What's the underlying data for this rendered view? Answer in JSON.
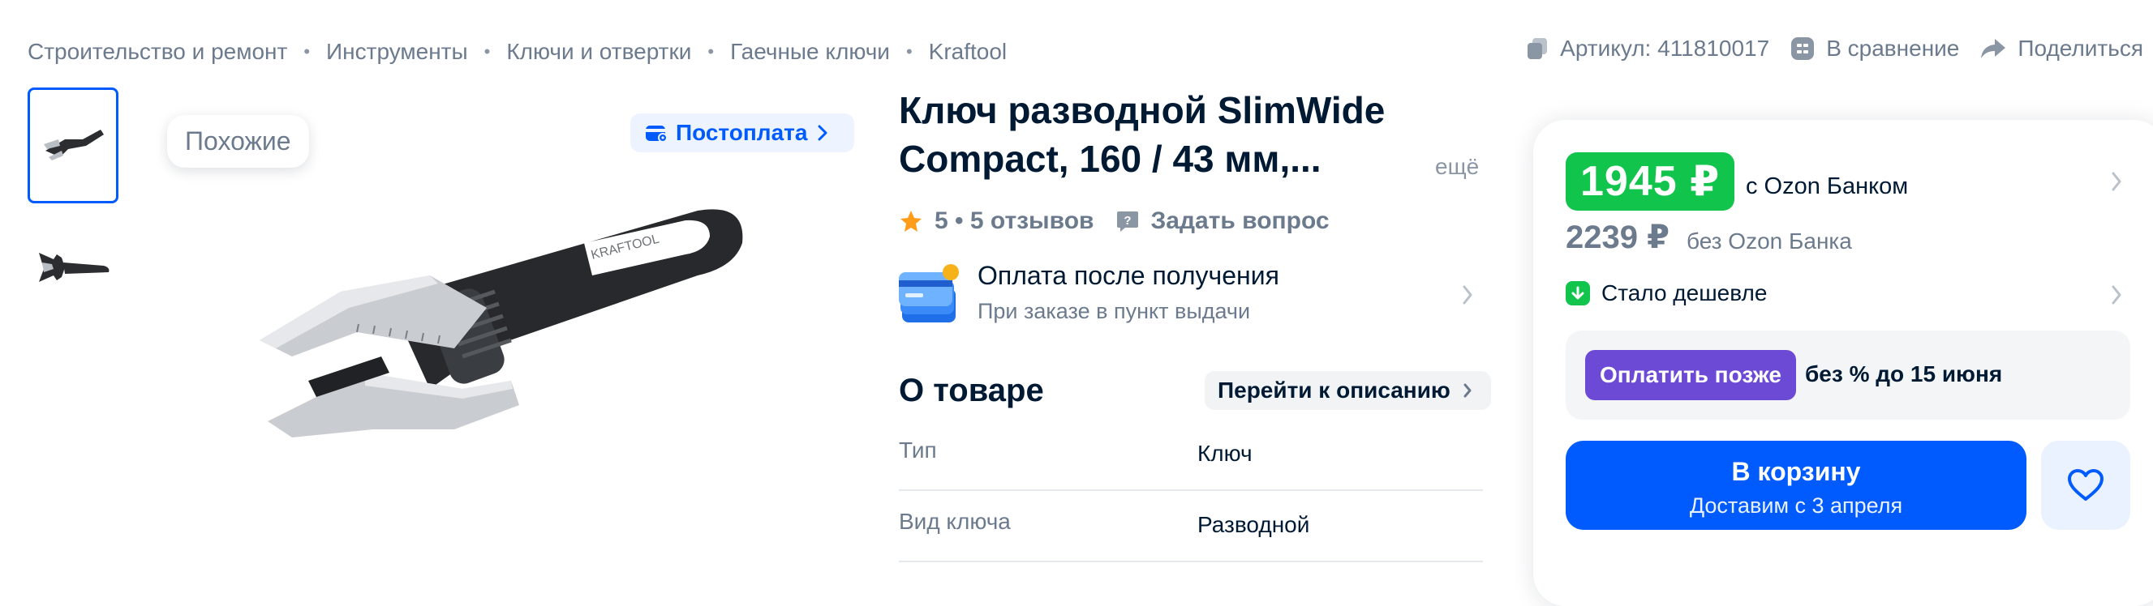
{
  "breadcrumbs": [
    "Строительство и ремонт",
    "Инструменты",
    "Ключи и отвертки",
    "Гаечные ключи",
    "Kraftool"
  ],
  "breadcrumb_separator": "•",
  "top_actions": {
    "article": "Артикул: 411810017",
    "compare": "В сравнение",
    "share": "Поделиться"
  },
  "gallery": {
    "similar_label": "Похожие",
    "postpay_label": "Постоплата",
    "thumbnail_count": 2,
    "active_thumbnail": 1
  },
  "product": {
    "title": "Ключ разводной SlimWide Compact, 160 / 43 мм,...",
    "more_label": "ещё",
    "rating_text": "5 • 5 отзывов",
    "ask_label": "Задать вопрос",
    "pay_after_title": "Оплата после получения",
    "pay_after_sub": "При заказе в пункт выдачи"
  },
  "about": {
    "heading": "О товаре",
    "go_to_description": "Перейти к описанию",
    "specs": [
      {
        "key": "Тип",
        "value": "Ключ"
      },
      {
        "key": "Вид ключа",
        "value": "Разводной"
      }
    ]
  },
  "price_panel": {
    "card_price": "1945 ₽",
    "card_price_label": "с Ozon Банком",
    "regular_price": "2239 ₽",
    "regular_price_label": "без Ozon Банка",
    "cheaper_label": "Стало дешевле",
    "pay_later_button": "Оплатить позже",
    "pay_later_text": "без % до 15 июня",
    "cart_button": "В корзину",
    "delivery_text": "Доставим с 3 апреля"
  },
  "colors": {
    "accent": "#005bff",
    "green": "#10c44c",
    "purple": "#6d4ad6",
    "text": "#001a34",
    "muted": "#6b7a8c"
  },
  "icons": [
    "article-copy-icon",
    "compare-icon",
    "share-icon",
    "star-icon",
    "question-icon",
    "card-icon",
    "chevron-right-icon",
    "arrow-down-icon",
    "heart-icon",
    "wallet-icon"
  ]
}
